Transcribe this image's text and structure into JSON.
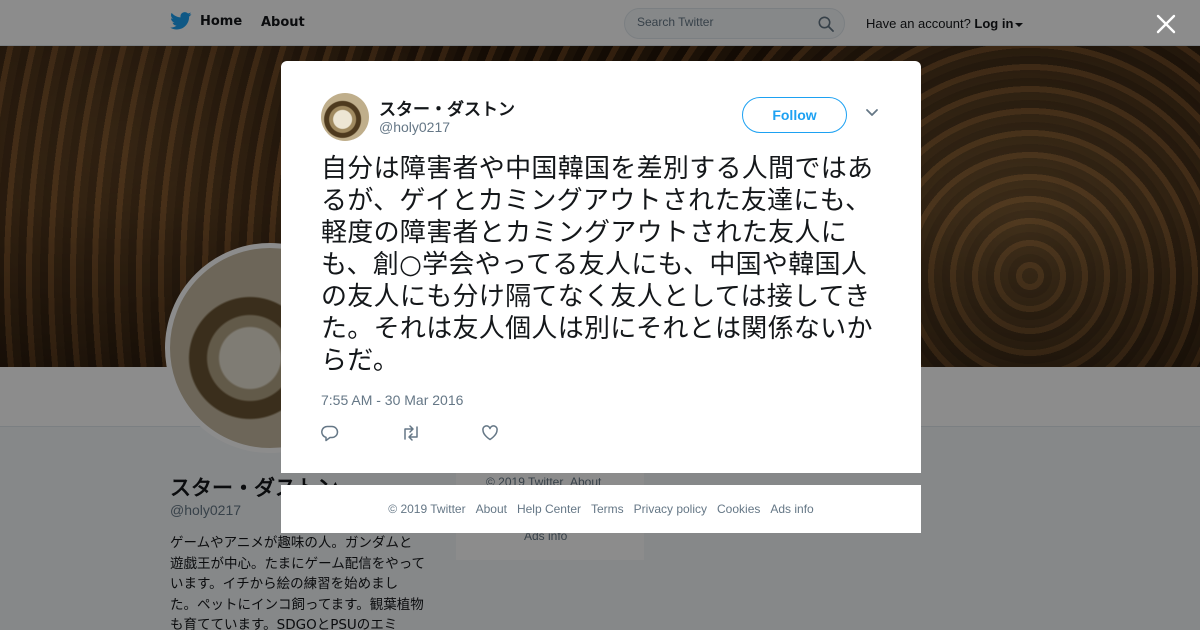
{
  "topbar": {
    "home_label": "Home",
    "about_label": "About",
    "search_placeholder": "Search Twitter",
    "account_prompt": "Have an account?",
    "login_label": "Log in"
  },
  "profile": {
    "name": "スター・ダストン",
    "handle": "@holy0217",
    "bio": "ゲームやアニメが趣味の人。ガンダムと遊戯王が中心。たまにゲーム配信をやっています。イチから絵の練習を始めました。ペットにインコ飼ってます。観葉植物も育てています。SDGOとPSUのエミ"
  },
  "side_card": {
    "copyright": "© 2019 Twitter",
    "about": "About",
    "ads": "Ads info"
  },
  "tweet": {
    "author_name": "スター・ダストン",
    "author_handle": "@holy0217",
    "follow_label": "Follow",
    "text": "自分は障害者や中国韓国を差別する人間ではあるが、ゲイとカミングアウトされた友達にも、軽度の障害者とカミングアウトされた友人にも、創○学会やってる友人にも、中国や韓国人の友人にも分け隔てなく友人としては接してきた。それは友人個人は別にそれとは関係ないからだ。",
    "timestamp": "7:55 AM - 30 Mar 2016"
  },
  "footer": {
    "copyright": "© 2019 Twitter",
    "links": [
      "About",
      "Help Center",
      "Terms",
      "Privacy policy",
      "Cookies",
      "Ads info"
    ]
  },
  "icons": {
    "brand": "twitter-bird-icon",
    "search": "search-icon",
    "close": "close-icon",
    "chevron": "chevron-down-icon",
    "reply": "reply-icon",
    "retweet": "retweet-icon",
    "like": "heart-icon"
  },
  "colors": {
    "accent": "#1da1f2",
    "text": "#14171a",
    "muted": "#657786"
  }
}
